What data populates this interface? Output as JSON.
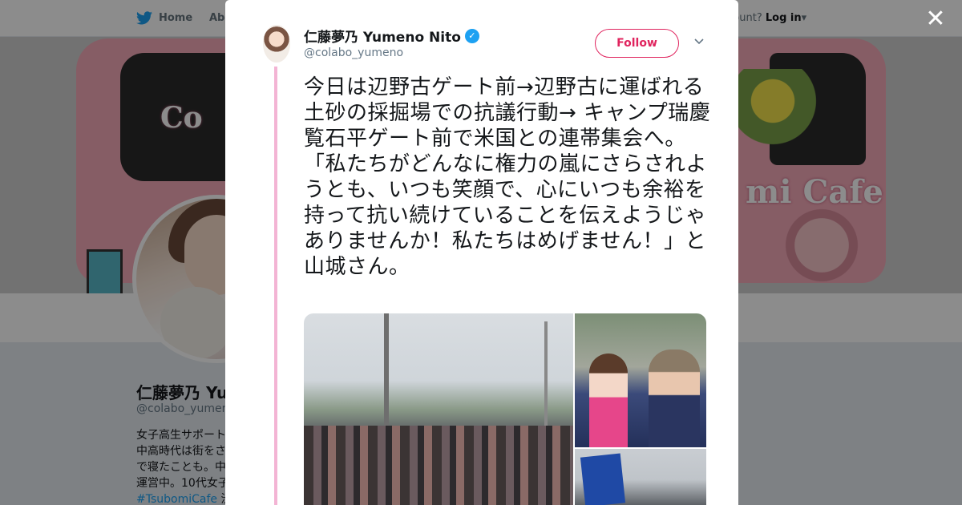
{
  "nav": {
    "home_label": "Home",
    "about_label": "Abo",
    "account_prompt": "ccount?",
    "login_label": "Log in",
    "login_caret": "▾"
  },
  "banner": {
    "bus_text_right": "mi Cafe",
    "bus_text_left": "Co"
  },
  "background_profile": {
    "name": "仁藤夢乃 Yu",
    "handle": "@colabo_yumeno",
    "bio_lines": [
      "女子高生サポート",
      "中高時代は街をさ",
      "で寝たことも。中",
      "運営中。10代女子"
    ],
    "hashtag": "#TsubomiCafe",
    "hashtag_suffix": " 渋谷"
  },
  "modal": {
    "author_name": "仁藤夢乃 Yumeno Nito",
    "verified_mark": "✓",
    "handle": "@colabo_yumeno",
    "follow_label": "Follow",
    "caret": "⌄",
    "tweet_text": "今日は辺野古ゲート前→辺野古に運ばれる土砂の採掘場での抗議行動→ キャンプ瑞慶覧石平ゲート前で米国との連帯集会へ。\n「私たちがどんなに権力の嵐にさらされようとも、いつも笑顔で、心にいつも余裕を持って抗い続けていることを伝えようじゃありませんか！私たちはめげません！」と山城さん。"
  },
  "close_symbol": "✕",
  "colors": {
    "twitter_blue": "#1da1f2",
    "follow_accent": "#e0245e",
    "thread_line": "#f3b4d4"
  }
}
